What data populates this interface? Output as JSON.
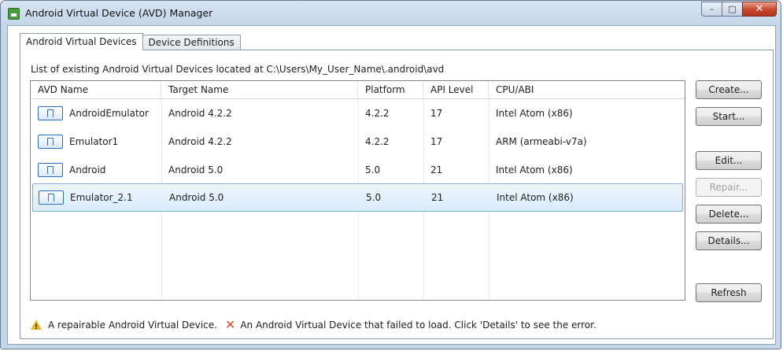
{
  "window": {
    "title": "Android Virtual Device (AVD) Manager",
    "controls": {
      "minimize": "–",
      "maximize": "□",
      "close": "✕"
    }
  },
  "tabs": [
    {
      "label": "Android Virtual Devices",
      "active": true
    },
    {
      "label": "Device Definitions",
      "active": false
    }
  ],
  "info_text": "List of existing Android Virtual Devices located at C:\\Users\\My_User_Name\\.android\\avd",
  "table": {
    "columns": [
      "AVD Name",
      "Target Name",
      "Platform",
      "API Level",
      "CPU/ABI"
    ],
    "rows": [
      {
        "name": "AndroidEmulator",
        "target": "Android 4.2.2",
        "platform": "4.2.2",
        "api": "17",
        "cpu": "Intel Atom (x86)",
        "selected": false
      },
      {
        "name": "Emulator1",
        "target": "Android 4.2.2",
        "platform": "4.2.2",
        "api": "17",
        "cpu": "ARM (armeabi-v7a)",
        "selected": false
      },
      {
        "name": "Android",
        "target": "Android 5.0",
        "platform": "5.0",
        "api": "21",
        "cpu": "Intel Atom (x86)",
        "selected": false
      },
      {
        "name": "Emulator_2.1",
        "target": "Android 5.0",
        "platform": "5.0",
        "api": "21",
        "cpu": "Intel Atom (x86)",
        "selected": true
      }
    ]
  },
  "buttons": {
    "create": "Create...",
    "start": "Start...",
    "edit": "Edit...",
    "repair": "Repair...",
    "delete": "Delete...",
    "details": "Details...",
    "refresh": "Refresh"
  },
  "legend": {
    "repairable": "A repairable Android Virtual Device.",
    "failed": "An Android Virtual Device that failed to load. Click 'Details' to see the error."
  },
  "colors": {
    "selection": "#d9ebfb",
    "selection_border": "#84acdd",
    "warning": "#e8b92b",
    "error": "#e0452f"
  }
}
